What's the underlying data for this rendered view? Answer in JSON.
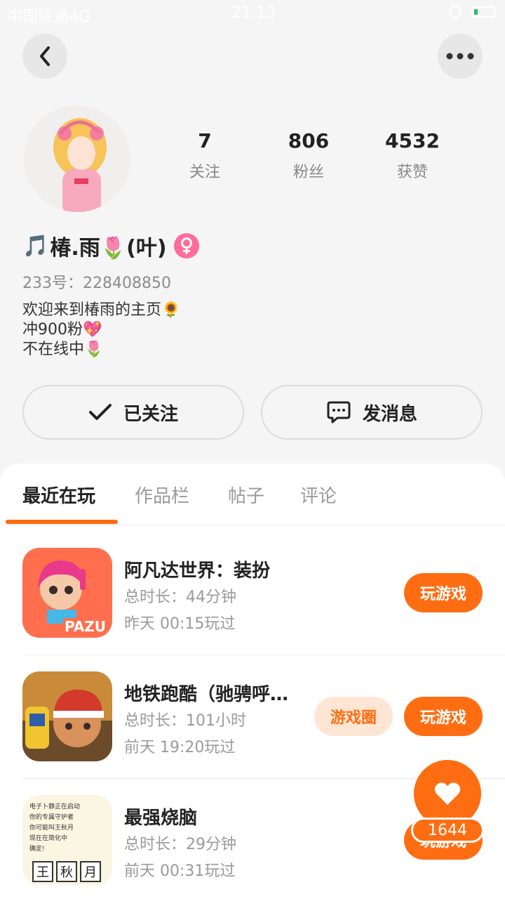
{
  "status_bar": {
    "carrier": "中国联通4G",
    "time": "21:13"
  },
  "profile": {
    "stats": [
      {
        "value": "7",
        "label": "关注"
      },
      {
        "value": "806",
        "label": "粉丝"
      },
      {
        "value": "4532",
        "label": "获赞"
      }
    ],
    "username_prefix": "🎵",
    "username": "椿.雨🌷(叶)",
    "uid": "233号：228408850",
    "bio_lines": [
      "欢迎来到椿雨的主页🌻",
      "冲900粉💖",
      "不在线中🌷"
    ]
  },
  "actions": {
    "follow_label": "已关注",
    "message_label": "发消息"
  },
  "tabs": [
    "最近在玩",
    "作品栏",
    "帖子",
    "评论"
  ],
  "games": [
    {
      "title": "阿凡达世界：装扮",
      "duration": "总时长：44分钟",
      "last_played": "昨天 00:15玩过",
      "play_label": "玩游戏",
      "icon_text": "PAZU"
    },
    {
      "title": "地铁跑酷（驰骋呼…",
      "duration": "总时长：101小时",
      "last_played": "前天 19:20玩过",
      "circle_label": "游戏圈",
      "play_label": "玩游戏"
    },
    {
      "title": "最强烧脑",
      "duration": "总时长：29分钟",
      "last_played": "前天 00:31玩过",
      "play_label": "玩游戏",
      "icon_lines": [
        "电子卜静正在启动",
        "你的专属守护者",
        "你可能叫王秋月",
        "现在在简化中",
        "确定!"
      ],
      "icon_chars": [
        "王",
        "秋",
        "月"
      ]
    }
  ],
  "fab": {
    "count": "1644"
  },
  "colors": {
    "accent": "#ff6d12",
    "accent_light": "#ffe6d4",
    "gender": "#ff6b9a"
  }
}
